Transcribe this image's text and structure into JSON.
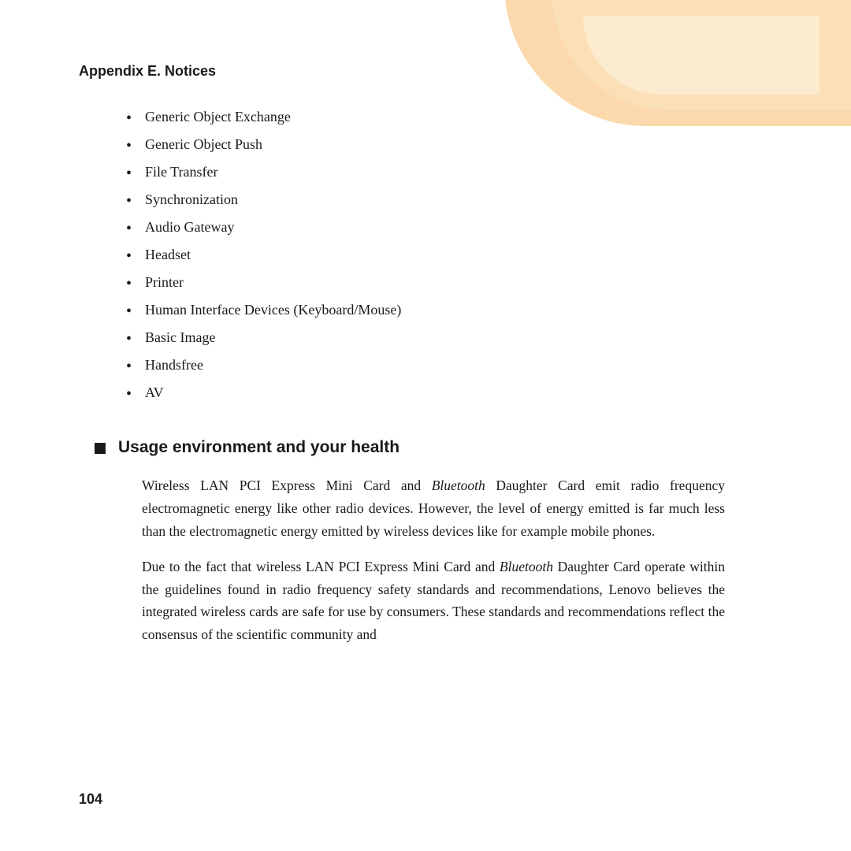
{
  "background": {
    "swirl_color_outer": "#f9c98a",
    "swirl_color_inner": "#fbe0b8",
    "swirl_color_highlight": "#fdecd2"
  },
  "header": {
    "title": "Appendix E. Notices"
  },
  "bullet_list": {
    "items": [
      {
        "text": "Generic Object Exchange"
      },
      {
        "text": "Generic Object Push"
      },
      {
        "text": "File Transfer"
      },
      {
        "text": "Synchronization"
      },
      {
        "text": "Audio Gateway"
      },
      {
        "text": "Headset"
      },
      {
        "text": "Printer"
      },
      {
        "text": "Human Interface Devices (Keyboard/Mouse)"
      },
      {
        "text": "Basic Image"
      },
      {
        "text": "Handsfree"
      },
      {
        "text": "AV"
      }
    ]
  },
  "section": {
    "heading": "Usage environment and your health",
    "paragraph1_start": "Wireless LAN PCI Express Mini Card and ",
    "paragraph1_italic": "Bluetooth",
    "paragraph1_end": " Daughter Card emit radio frequency electromagnetic energy like other radio devices. However, the level of energy emitted is far much less than the electromagnetic energy emitted by wireless devices like for example mobile phones.",
    "paragraph2_start": "Due to the fact that wireless LAN PCI Express Mini Card and ",
    "paragraph2_italic": "Bluetooth",
    "paragraph2_end": " Daughter Card operate within the guidelines found in radio frequency safety standards and recommendations, Lenovo believes the integrated wireless cards are safe for use by consumers. These standards and recommendations reflect the consensus of the scientific community and"
  },
  "page_number": "104"
}
